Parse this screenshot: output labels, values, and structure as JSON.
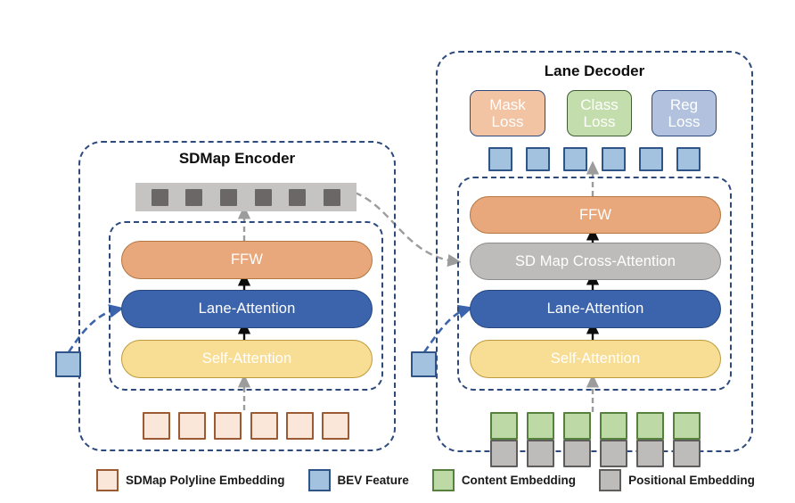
{
  "figure": {
    "type": "architecture-diagram",
    "background": "#ffffff"
  },
  "encoder": {
    "title": "SDMap Encoder",
    "layers": [
      {
        "label": "FFW",
        "color": "#e8a87c"
      },
      {
        "label": "Lane-Attention",
        "color": "#3b64ad"
      },
      {
        "label": "Self-Attention",
        "color": "#f8dd94"
      }
    ],
    "output_strip": {
      "token_count": 6,
      "strip_color": "#c6c4c2",
      "token_color": "#6a6766"
    },
    "input_tokens": {
      "count": 6,
      "kind": "sdmap-polyline-embedding",
      "color": "#fae7da"
    },
    "bev_input": {
      "kind": "bev-feature",
      "color": "#a3c2e0"
    }
  },
  "decoder": {
    "title": "Lane Decoder",
    "losses": [
      {
        "line1": "Mask",
        "line2": "Loss",
        "color": "#f2c4a4"
      },
      {
        "line1": "Class",
        "line2": "Loss",
        "color": "#c3ddac"
      },
      {
        "line1": "Reg",
        "line2": "Loss",
        "color": "#b2c2de"
      }
    ],
    "output_tokens": {
      "count": 6,
      "kind": "bev-feature",
      "color": "#a3c2e0"
    },
    "layers": [
      {
        "label": "FFW",
        "color": "#e8a87c"
      },
      {
        "label": "SD Map Cross-Attention",
        "color": "#bdbcba"
      },
      {
        "label": "Lane-Attention",
        "color": "#3b64ad"
      },
      {
        "label": "Self-Attention",
        "color": "#f8dd94"
      }
    ],
    "input_tokens": {
      "count": 6,
      "top": {
        "kind": "content-embedding",
        "color": "#bcd9a6"
      },
      "bottom": {
        "kind": "positional-embedding",
        "color": "#bdbcba"
      }
    },
    "bev_input": {
      "kind": "bev-feature",
      "color": "#a3c2e0"
    }
  },
  "legend": {
    "items": [
      {
        "label": "SDMap Polyline Embedding",
        "color": "#fae7da",
        "border": "#9a5b34"
      },
      {
        "label": "BEV Feature",
        "color": "#a3c2e0",
        "border": "#2f5488"
      },
      {
        "label": "Content Embedding",
        "color": "#bcd9a6",
        "border": "#56813c"
      },
      {
        "label": "Positional Embedding",
        "color": "#bdbcba",
        "border": "#5f5d5b"
      }
    ]
  },
  "connectors": {
    "solid_arrow_color": "#0d0d0d",
    "gray_dashed_color": "#9c9c9c",
    "blue_dashed_color": "#3b64ad"
  }
}
